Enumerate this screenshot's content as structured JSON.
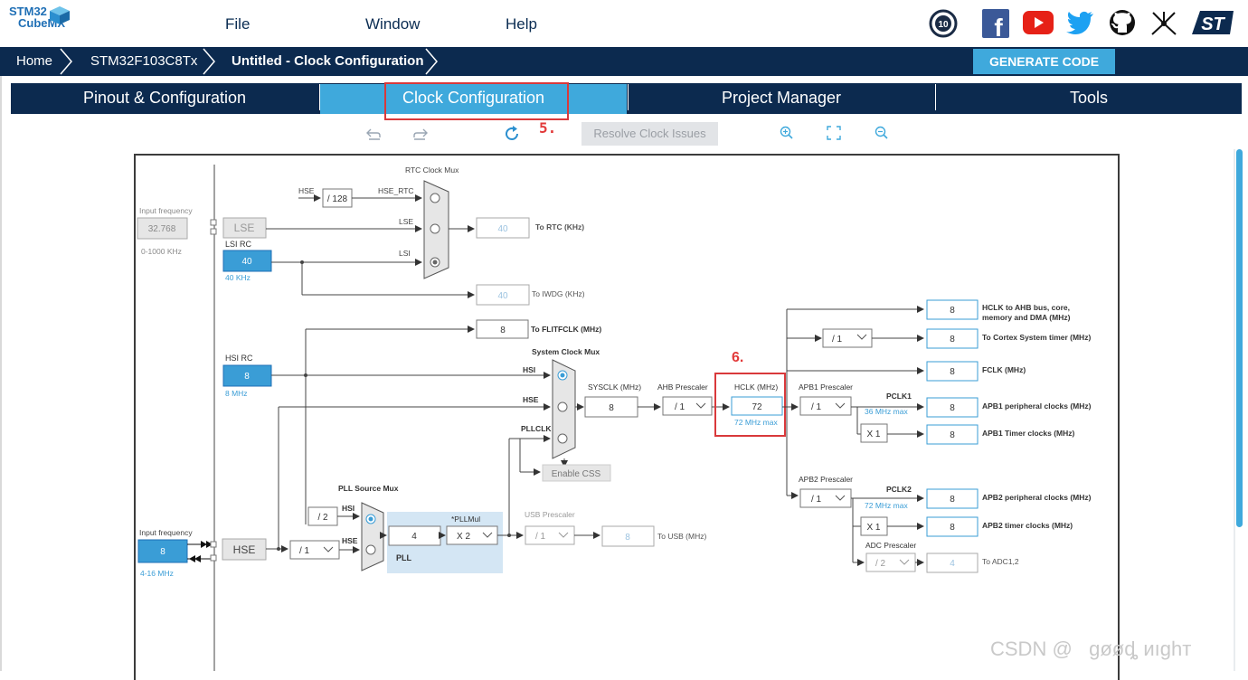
{
  "logo": {
    "line1": "STM32",
    "line2": "CubeMX"
  },
  "menu": {
    "file": "File",
    "window": "Window",
    "help": "Help"
  },
  "social_icons": [
    "anniversary-10-icon",
    "facebook-icon",
    "youtube-icon",
    "twitter-icon",
    "github-icon",
    "network-icon",
    "st-logo-icon"
  ],
  "breadcrumb": {
    "home": "Home",
    "device": "STM32F103C8Tx",
    "project": "Untitled - Clock Configuration"
  },
  "generate_label": "GENERATE CODE",
  "tabs": [
    {
      "label": "Pinout & Configuration"
    },
    {
      "label": "Clock Configuration"
    },
    {
      "label": "Project Manager"
    },
    {
      "label": "Tools"
    }
  ],
  "toolbar": {
    "resolve": "Resolve Clock Issues"
  },
  "annotations": {
    "a5": "5.",
    "a6": "6."
  },
  "colors": {
    "navy": "#0c2a4f",
    "accent": "#3fa9dc",
    "red": "#d9393b"
  },
  "diagram": {
    "input_freq_label": "Input frequency",
    "lse_input": "32.768",
    "lse_range": "0-1000 KHz",
    "lse": "LSE",
    "lsi_rc": "LSI RC",
    "lsi_value": "40",
    "lsi_unit": "40 KHz",
    "rtc_mux": "RTC Clock Mux",
    "hse": "HSE",
    "div128": "/ 128",
    "hse_rtc": "HSE_RTC",
    "lse_in": "LSE",
    "lsi_in": "LSI",
    "rtc_value": "40",
    "to_rtc": "To RTC (KHz)",
    "iwdg_value": "40",
    "to_iwdg": "To IWDG (KHz)",
    "flit_value": "8",
    "to_flit": "To FLITFCLK (MHz)",
    "hsi_rc": "HSI RC",
    "hsi_value": "8",
    "hsi_unit": "8 MHz",
    "sys_mux": "System Clock Mux",
    "hsi_in": "HSI",
    "hse_in": "HSE",
    "pllclk_in": "PLLCLK",
    "enable_css": "Enable CSS",
    "sysclk_label": "SYSCLK (MHz)",
    "sysclk_value": "8",
    "ahb_label": "AHB Prescaler",
    "ahb_value": "/ 1",
    "hclk_label": "HCLK (MHz)",
    "hclk_value": "72",
    "hclk_max": "72 MHz max",
    "apb1_label": "APB1 Prescaler",
    "apb1_value": "/ 1",
    "pclk1": "PCLK1",
    "pclk1_max": "36 MHz max",
    "x1a": "X 1",
    "apb2_label": "APB2 Prescaler",
    "apb2_value": "/ 1",
    "pclk2": "PCLK2",
    "pclk2_max": "72 MHz max",
    "x1b": "X 1",
    "adc_label": "ADC Prescaler",
    "adc_value": "/ 2",
    "cortex_div": "/ 1",
    "outputs": [
      {
        "value": "8",
        "label": "HCLK to AHB bus, core,",
        "label2": "memory and DMA (MHz)"
      },
      {
        "value": "8",
        "label": "To Cortex System timer (MHz)"
      },
      {
        "value": "8",
        "label": "FCLK (MHz)"
      },
      {
        "value": "8",
        "label": "APB1 peripheral clocks (MHz)"
      },
      {
        "value": "8",
        "label": "APB1 Timer clocks (MHz)"
      },
      {
        "value": "8",
        "label": "APB2 peripheral clocks (MHz)"
      },
      {
        "value": "8",
        "label": "APB2 timer clocks (MHz)"
      },
      {
        "value": "4",
        "label": "To ADC1,2"
      }
    ],
    "pll_src_mux": "PLL Source Mux",
    "div2": "/ 2",
    "pll_hsi": "HSI",
    "pll_hse": "HSE",
    "hse_input_label": "Input frequency",
    "hse_input": "8",
    "hse_range": "4-16 MHz",
    "hse_box": "HSE",
    "hse_div": "/ 1",
    "pll_value": "4",
    "pllmul_label": "*PLLMul",
    "pllmul_value": "X 2",
    "pll_label": "PLL",
    "usb_label": "USB Prescaler",
    "usb_div": "/ 1",
    "usb_value": "8",
    "to_usb": "To USB (MHz)"
  },
  "watermark": "CSDN @   ɡøøȡ иıɡһт"
}
